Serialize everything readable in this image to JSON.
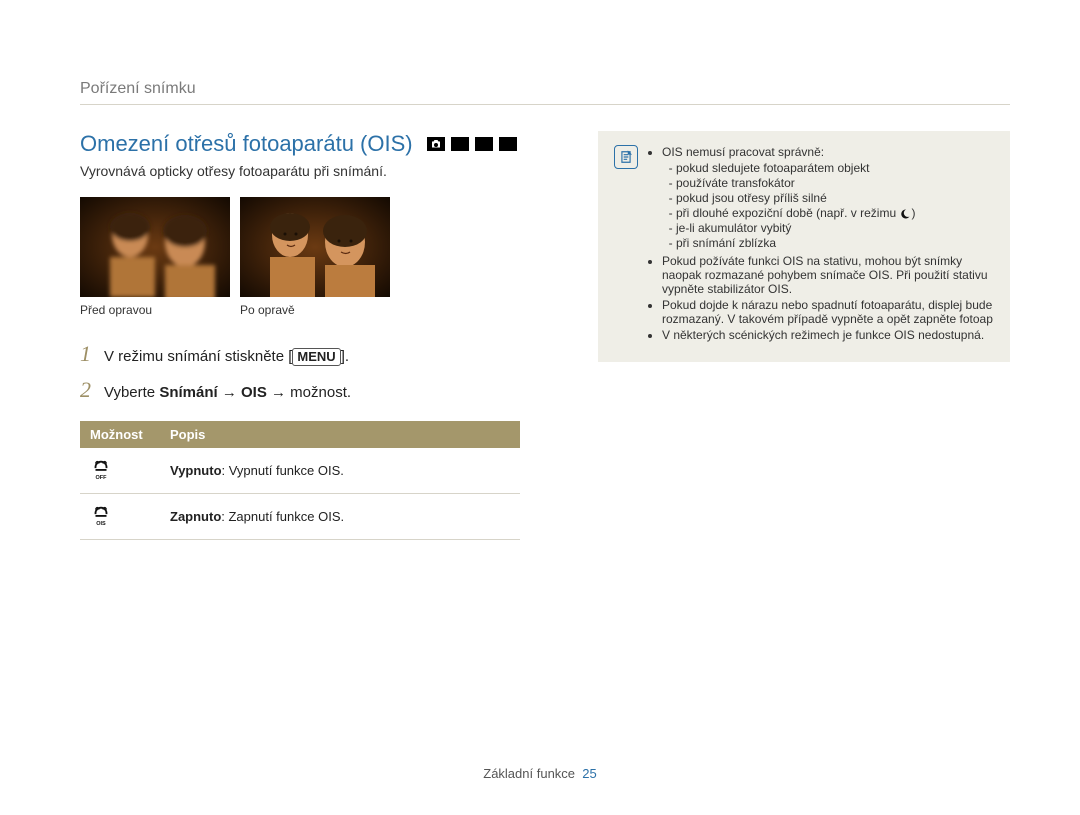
{
  "breadcrumb": "Pořízení snímku",
  "heading": "Omezení otřesů fotoaparátu (OIS)",
  "intro": "Vyrovnává opticky otřesy fotoaparátu při snímání.",
  "captions": {
    "before": "Před opravou",
    "after": "Po opravě"
  },
  "steps": {
    "s1_a": "V režimu snímání stiskněte [",
    "s1_menu": "MENU",
    "s1_b": "].",
    "s2_a": "Vyberte ",
    "s2_bold": "Snímání → OIS",
    "s2_b": " → možnost."
  },
  "table": {
    "h1": "Možnost",
    "h2": "Popis",
    "r1_bold": "Vypnuto",
    "r1_rest": ": Vypnutí funkce OIS.",
    "r2_bold": "Zapnuto",
    "r2_rest": ": Zapnutí funkce OIS."
  },
  "note": {
    "b1": "OIS nemusí pracovat správně:",
    "b1_1": "pokud sledujete fotoaparátem objekt",
    "b1_2": "používáte transfokátor",
    "b1_3": "pokud jsou otřesy příliš silné",
    "b1_4a": "při dlouhé expoziční době (např. v režimu ",
    "b1_4b": ")",
    "b1_5": "je-li akumulátor vybitý",
    "b1_6": "při snímání zblízka",
    "b2": "Pokud požíváte funkci OIS na stativu, mohou být snímky naopak rozmazané pohybem snímače OIS. Při použití stativu vypněte stabilizátor OIS.",
    "b3": "Pokud dojde k nárazu nebo spadnutí fotoaparátu, displej bude rozmazaný. V takovém případě vypněte a opět zapněte fotoap",
    "b4": "V některých scénických režimech je funkce OIS nedostupná."
  },
  "footer": {
    "label": "Základní funkce",
    "page": "25"
  }
}
